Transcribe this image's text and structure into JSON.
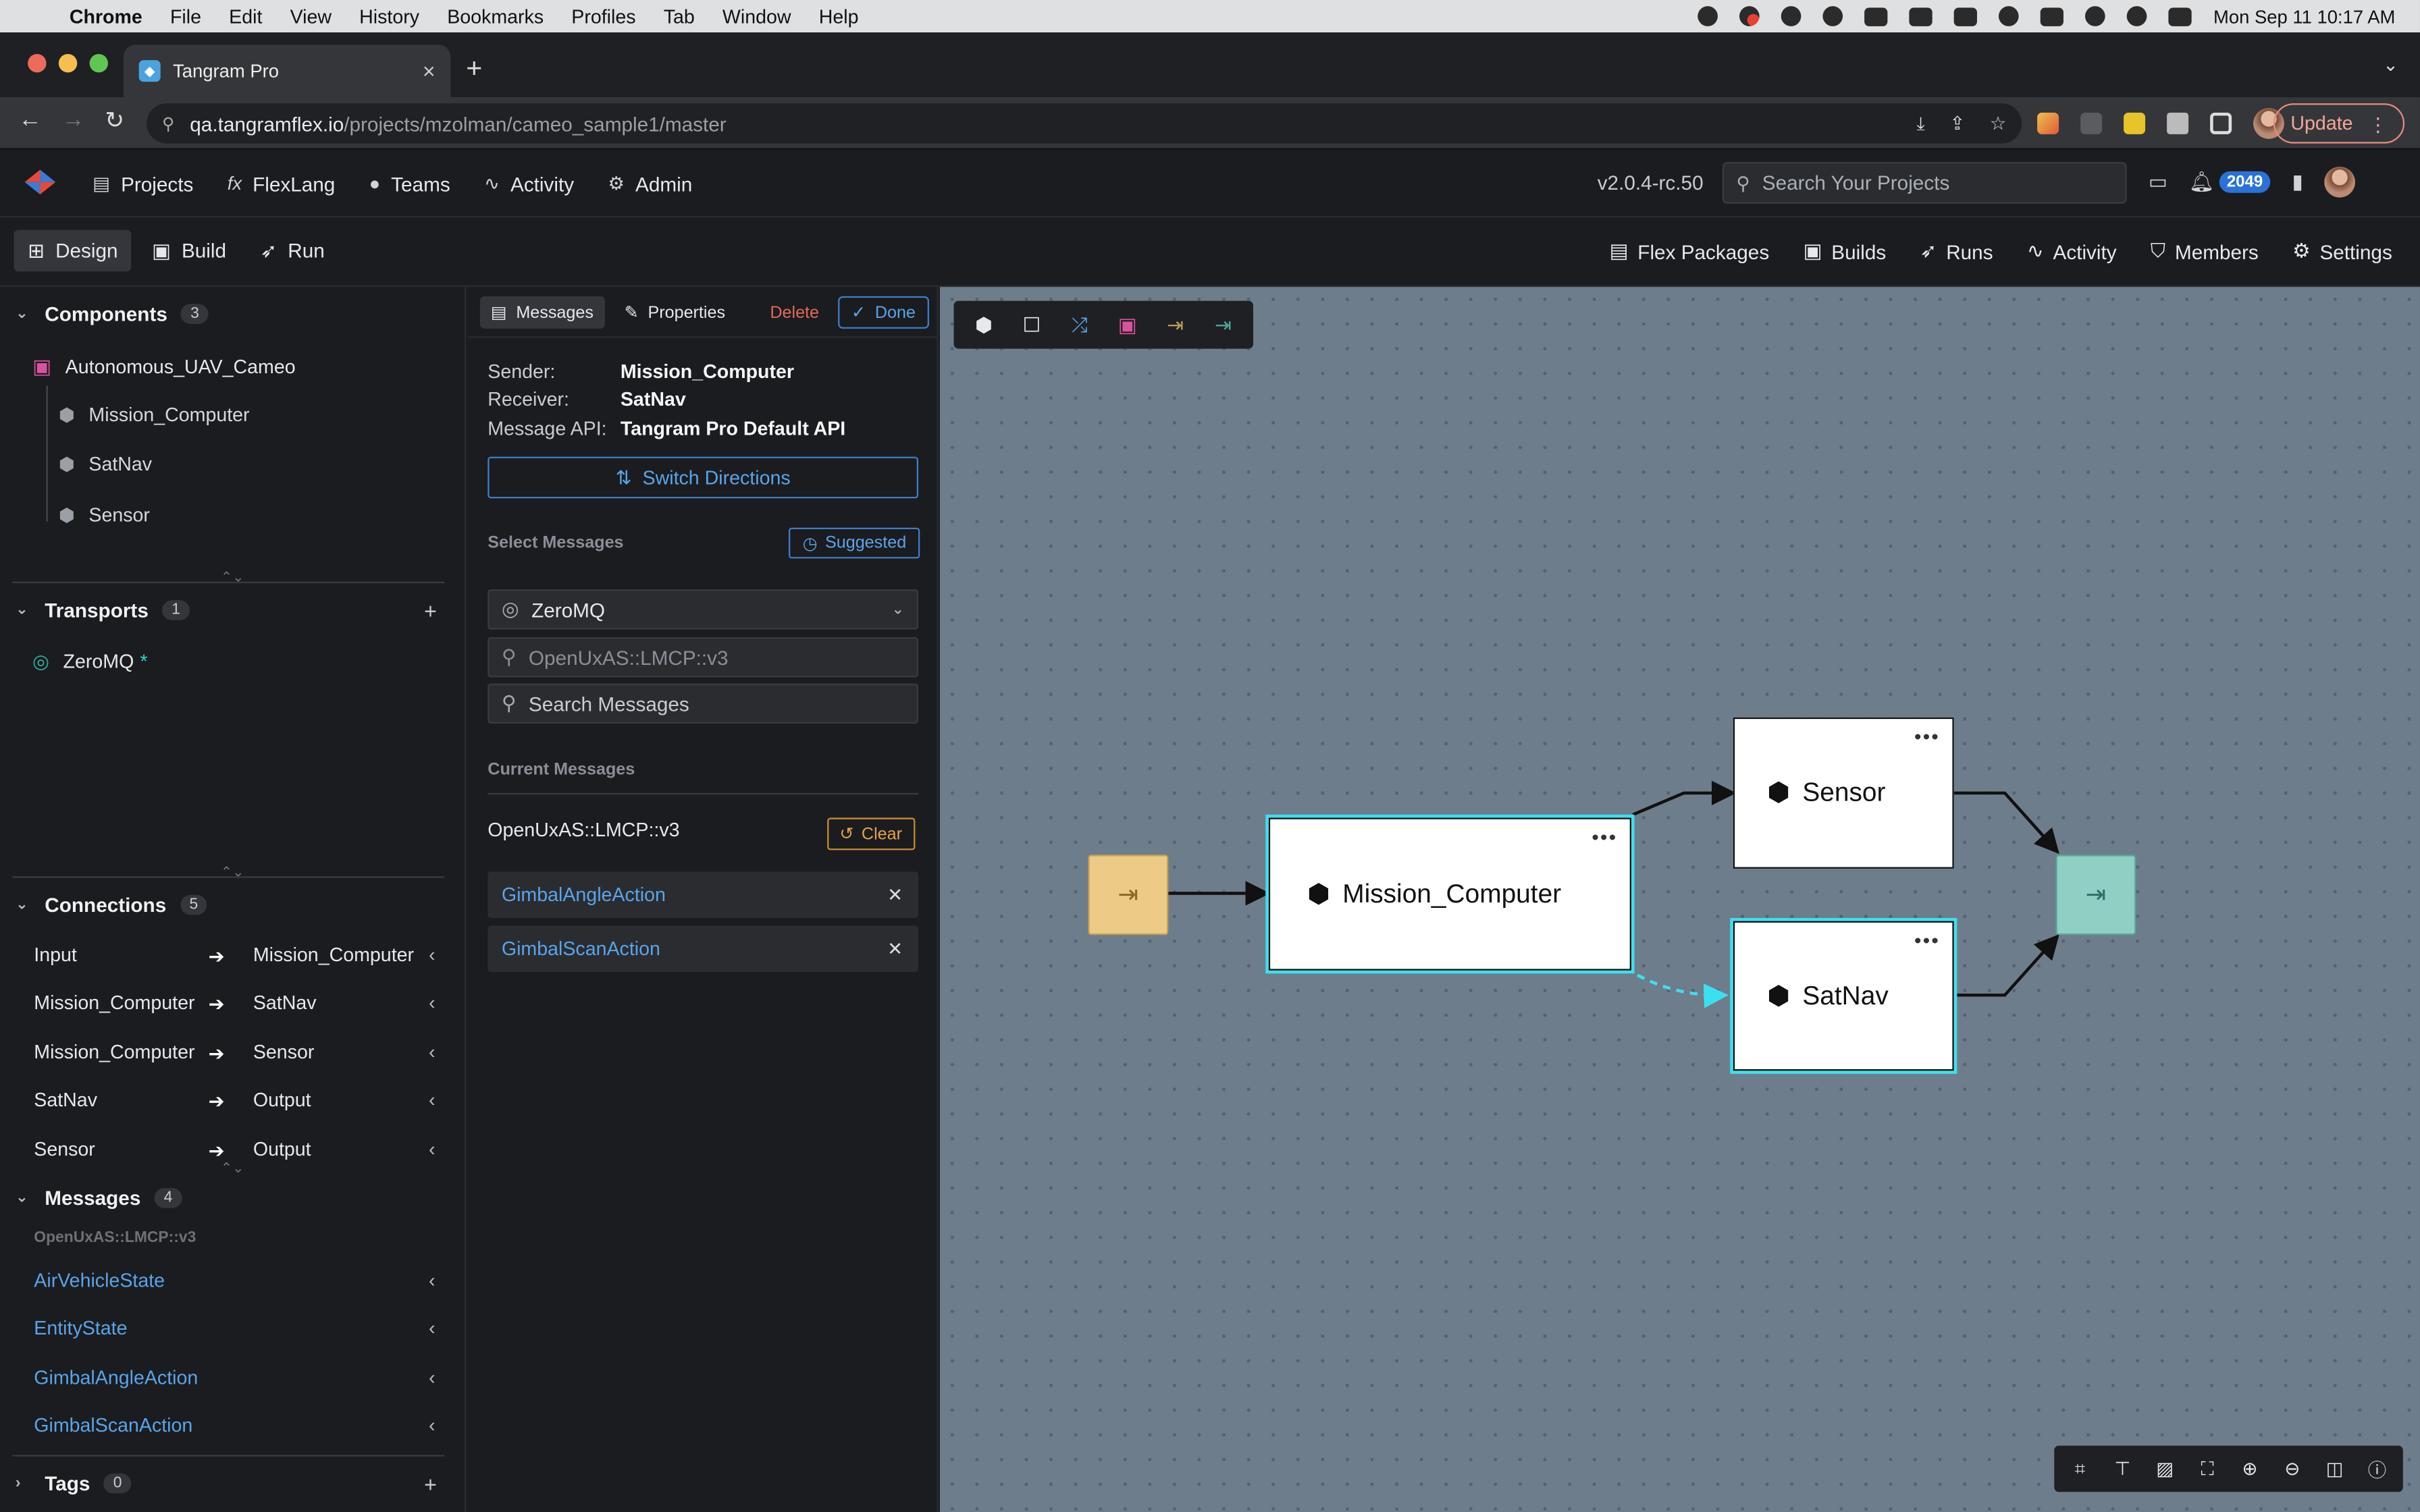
{
  "menubar": {
    "app": "Chrome",
    "items": [
      "File",
      "Edit",
      "View",
      "History",
      "Bookmarks",
      "Profiles",
      "Tab",
      "Window",
      "Help"
    ],
    "clock": "Mon Sep 11  10:17 AM"
  },
  "browser": {
    "tab_title": "Tangram Pro",
    "url_host": "qa.tangramflex.io",
    "url_path": "/projects/mzolman/cameo_sample1/master",
    "update_label": "Update"
  },
  "header": {
    "nav": [
      {
        "label": "Projects",
        "icon": "folder-icon"
      },
      {
        "label": "FlexLang",
        "icon": "fx-icon"
      },
      {
        "label": "Teams",
        "icon": "team-icon"
      },
      {
        "label": "Activity",
        "icon": "pulse-icon"
      },
      {
        "label": "Admin",
        "icon": "gear-icon"
      }
    ],
    "version": "v2.0.4-rc.50",
    "search_placeholder": "Search Your Projects",
    "notification_count": "2049"
  },
  "project_bar": {
    "modes": [
      "Design",
      "Build",
      "Run"
    ],
    "active_mode": "Design",
    "right": [
      "Flex Packages",
      "Builds",
      "Runs",
      "Activity",
      "Members",
      "Settings"
    ]
  },
  "sidebar": {
    "components": {
      "title": "Components",
      "count": "3",
      "root": "Autonomous_UAV_Cameo",
      "children": [
        "Mission_Computer",
        "SatNav",
        "Sensor"
      ]
    },
    "transports": {
      "title": "Transports",
      "count": "1",
      "items": [
        {
          "name": "ZeroMQ",
          "marker": "*"
        }
      ]
    },
    "connections": {
      "title": "Connections",
      "count": "5",
      "items": [
        {
          "from": "Input",
          "to": "Mission_Computer"
        },
        {
          "from": "Mission_Computer",
          "to": "SatNav"
        },
        {
          "from": "Mission_Computer",
          "to": "Sensor"
        },
        {
          "from": "SatNav",
          "to": "Output"
        },
        {
          "from": "Sensor",
          "to": "Output"
        }
      ]
    },
    "messages": {
      "title": "Messages",
      "count": "4",
      "group": "OpenUxAS::LMCP::v3",
      "items": [
        "AirVehicleState",
        "EntityState",
        "GimbalAngleAction",
        "GimbalScanAction"
      ]
    },
    "tags": {
      "title": "Tags",
      "count": "0"
    }
  },
  "panel": {
    "tabs": [
      "Messages",
      "Properties"
    ],
    "delete_label": "Delete",
    "done_label": "Done",
    "sender_label": "Sender:",
    "sender": "Mission_Computer",
    "receiver_label": "Receiver:",
    "receiver": "SatNav",
    "api_label": "Message API:",
    "api": "Tangram Pro Default API",
    "switch_label": "Switch Directions",
    "select_messages_label": "Select Messages",
    "suggested_label": "Suggested",
    "transport_value": "ZeroMQ",
    "package_placeholder": "OpenUxAS::LMCP::v3",
    "search_placeholder": "Search Messages",
    "current_messages_label": "Current Messages",
    "current_package": "OpenUxAS::LMCP::v3",
    "clear_label": "Clear",
    "current_items": [
      "GimbalAngleAction",
      "GimbalScanAction"
    ]
  },
  "canvas": {
    "nodes": {
      "mission": "Mission_Computer",
      "sensor": "Sensor",
      "satnav": "SatNav"
    },
    "colors": {
      "input_terminal": "#eccb86",
      "output_terminal": "#8fcfc4",
      "selection": "#3be0f0",
      "background": "#6e7d8b"
    }
  }
}
